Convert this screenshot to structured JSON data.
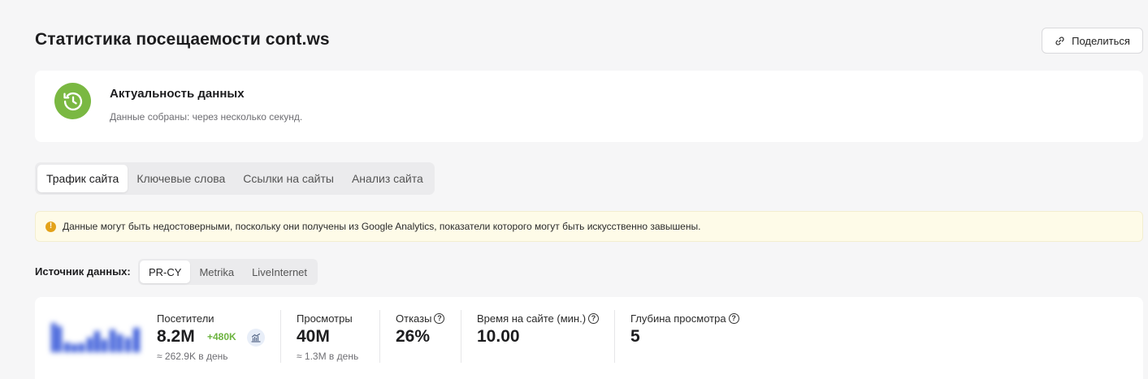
{
  "header": {
    "title": "Статистика посещаемости cont.ws",
    "share_label": "Поделиться"
  },
  "freshness": {
    "title": "Актуальность данных",
    "subtitle": "Данные собраны: через несколько секунд."
  },
  "tabs": [
    {
      "label": "Трафик сайта",
      "active": true
    },
    {
      "label": "Ключевые слова",
      "active": false
    },
    {
      "label": "Ссылки на сайты",
      "active": false
    },
    {
      "label": "Анализ сайта",
      "active": false
    }
  ],
  "warning": {
    "icon": "!",
    "text": "Данные могут быть недостоверными, поскольку они получены из Google Analytics, показатели которого могут быть искусственно завышены."
  },
  "source": {
    "label": "Источник данных:",
    "options": [
      {
        "label": "PR-CY",
        "active": true
      },
      {
        "label": "Metrika",
        "active": false
      },
      {
        "label": "LiveInternet",
        "active": false
      }
    ]
  },
  "stats": {
    "visitors": {
      "label": "Посетители",
      "value": "8.2M",
      "delta": "+480K",
      "per_day": "≈ 262.9K в день"
    },
    "views": {
      "label": "Просмотры",
      "value": "40M",
      "per_day": "≈ 1.3M в день"
    },
    "bounces": {
      "label": "Отказы",
      "value": "26%"
    },
    "time": {
      "label": "Время на сайте (мин.)",
      "value": "10.00"
    },
    "depth": {
      "label": "Глубина просмотра",
      "value": "5"
    }
  },
  "colors": {
    "accent_green": "#7ab842",
    "delta_green": "#6cb33f",
    "warning_bg": "#fefbe8",
    "warning_icon": "#e3a21a",
    "sparkline_blue": "#3a5bd9"
  }
}
